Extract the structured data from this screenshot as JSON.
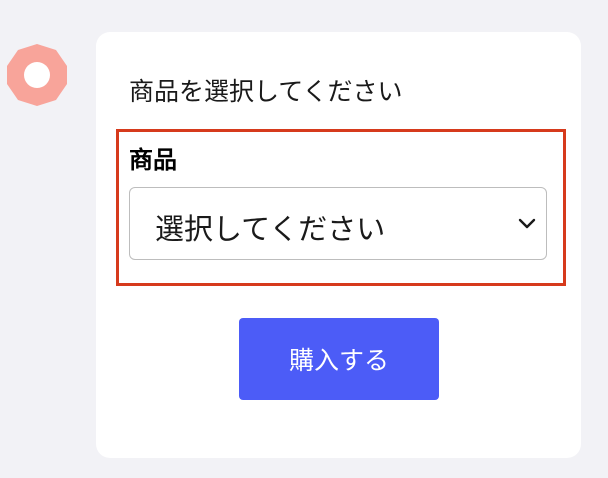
{
  "form": {
    "instruction": "商品を選択してください",
    "product_label": "商品",
    "product_select": {
      "selected_value": "選択してください"
    },
    "buy_button_label": "購入する"
  },
  "icons": {
    "cursor_ring": "ring-icon",
    "select_arrow": "chevron-down-icon"
  },
  "colors": {
    "background": "#f2f2f6",
    "card": "#ffffff",
    "highlight_border": "#d63a1c",
    "button": "#4c5cf7",
    "ring": "#f8a49a"
  }
}
